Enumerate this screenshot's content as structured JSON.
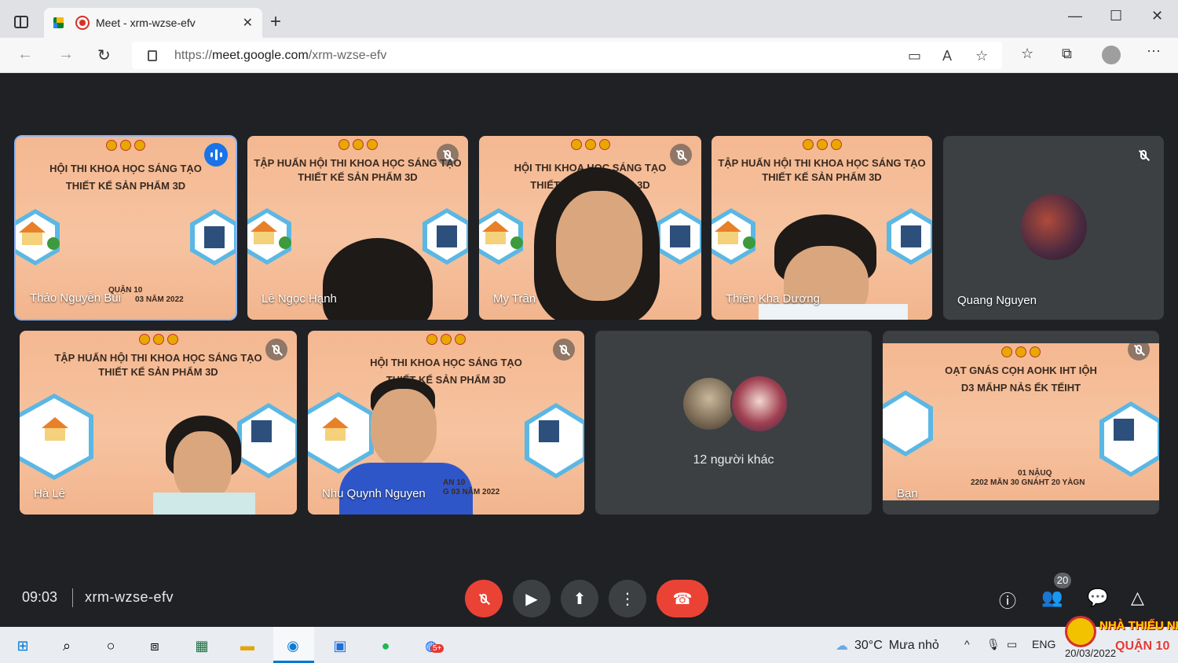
{
  "browser": {
    "tab_title": "Meet - xrm-wzse-efv",
    "url_scheme": "https://",
    "url_host": "meet.google.com",
    "url_path": "/xrm-wzse-efv"
  },
  "participants": [
    {
      "name": "Thảo Nguyễn Bùi",
      "state": "speaking"
    },
    {
      "name": "Lê Ngọc Hạnh",
      "state": "muted"
    },
    {
      "name": "My Trần",
      "state": "muted"
    },
    {
      "name": "Thiên Kha Dương",
      "state": "muted"
    },
    {
      "name": "Quang Nguyen",
      "state": "muted"
    },
    {
      "name": "Hà Lê",
      "state": "muted"
    },
    {
      "name": "Nhu Quynh Nguyen",
      "state": "muted"
    },
    {
      "name": "Bạn",
      "state": "muted"
    }
  ],
  "slides": {
    "title_a": "HỘI THI KHOA HỌC SÁNG TẠO",
    "subtitle": "THIẾT KẾ SẢN PHẨM 3D",
    "title_b": "TẬP HUẤN HỘI THI KHOA HỌC SÁNG TẠO",
    "mirrored_title": "OẠT GNÁS CỌH AOHK IHT IỘH",
    "mirrored_subtitle": "D3 MẨHP NẢS ẾK TẾIHT",
    "foot_district": "QUẬN 10",
    "foot_date": "03 NĂM 2022",
    "foot_date_b": "G 03 NĂM 2022",
    "foot_an": "AN 10",
    "mirrored_foot_district": "01 NẬUQ",
    "mirrored_foot_date": "2202 MĂN 30 GNÁHT 20 YÀGN"
  },
  "others_label": "12 người khác",
  "meeting": {
    "time": "09:03",
    "code": "xrm-wzse-efv",
    "participant_count": "20"
  },
  "taskbar": {
    "temperature": "30°C",
    "weather": "Mưa nhỏ",
    "language": "ENG",
    "date": "20/03/2022",
    "zalo_badge": "5+"
  },
  "watermark": {
    "line1": "NHÀ THIẾU NHI",
    "line2": "QUẬN 10"
  }
}
